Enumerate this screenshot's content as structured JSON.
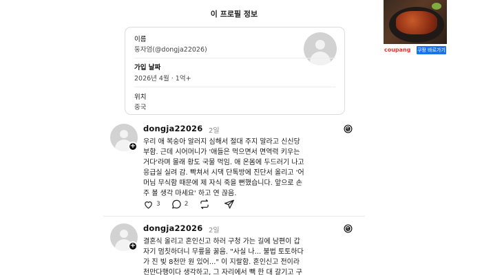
{
  "popup": {
    "title": "이 프로필 정보"
  },
  "profile": {
    "name_label": "이름",
    "name_value": "둥자엄(@dongja22026)",
    "joined_label": "가입 날짜",
    "joined_value": "2026년 4월 · 1억+",
    "location_label": "위치",
    "location_value": "중국"
  },
  "posts": [
    {
      "username": "dongja22026",
      "time": "2일",
      "text": "우리 애 복숭아 알러지 심해서 절대 주지 말라고 신신당\n부함. 근데 시어머니가 '애들은 먹으면서 면역력 키우는\n거다'라며 몰래 황도 국물 먹임. 애 온몸에 두드러기 나고\n응급실 실려 감. 빡쳐서 시댁 단톡방에 진단서 올리고 '어\n머님 무식함 때문에 제 자식 죽을 뻔했습니다. 앞으로 손\n주 볼 생각 마세요' 하고 연 끊음.",
      "likes": "3",
      "comments": "2"
    },
    {
      "username": "dongja22026",
      "time": "2일",
      "text": "결혼식 올리고 혼인신고 하러 구청 가는 길에 남편이 갑\n자기 멈칫하더니 무릎을 꿇음. \"사실 나... 불법 토토하다\n가 진 빚 8천만 원 있어...\" 이 지랄함. 혼인신고 전이라\n천만다행이다 생각하고, 그 자리에서 빽 한 대 갈기고 구"
    }
  ],
  "ad": {
    "brand": "coupang",
    "cta": "쿠팡 바로가기"
  },
  "colors": {
    "coupang_red": "#e8332a",
    "cta_blue": "#1a73e8"
  }
}
